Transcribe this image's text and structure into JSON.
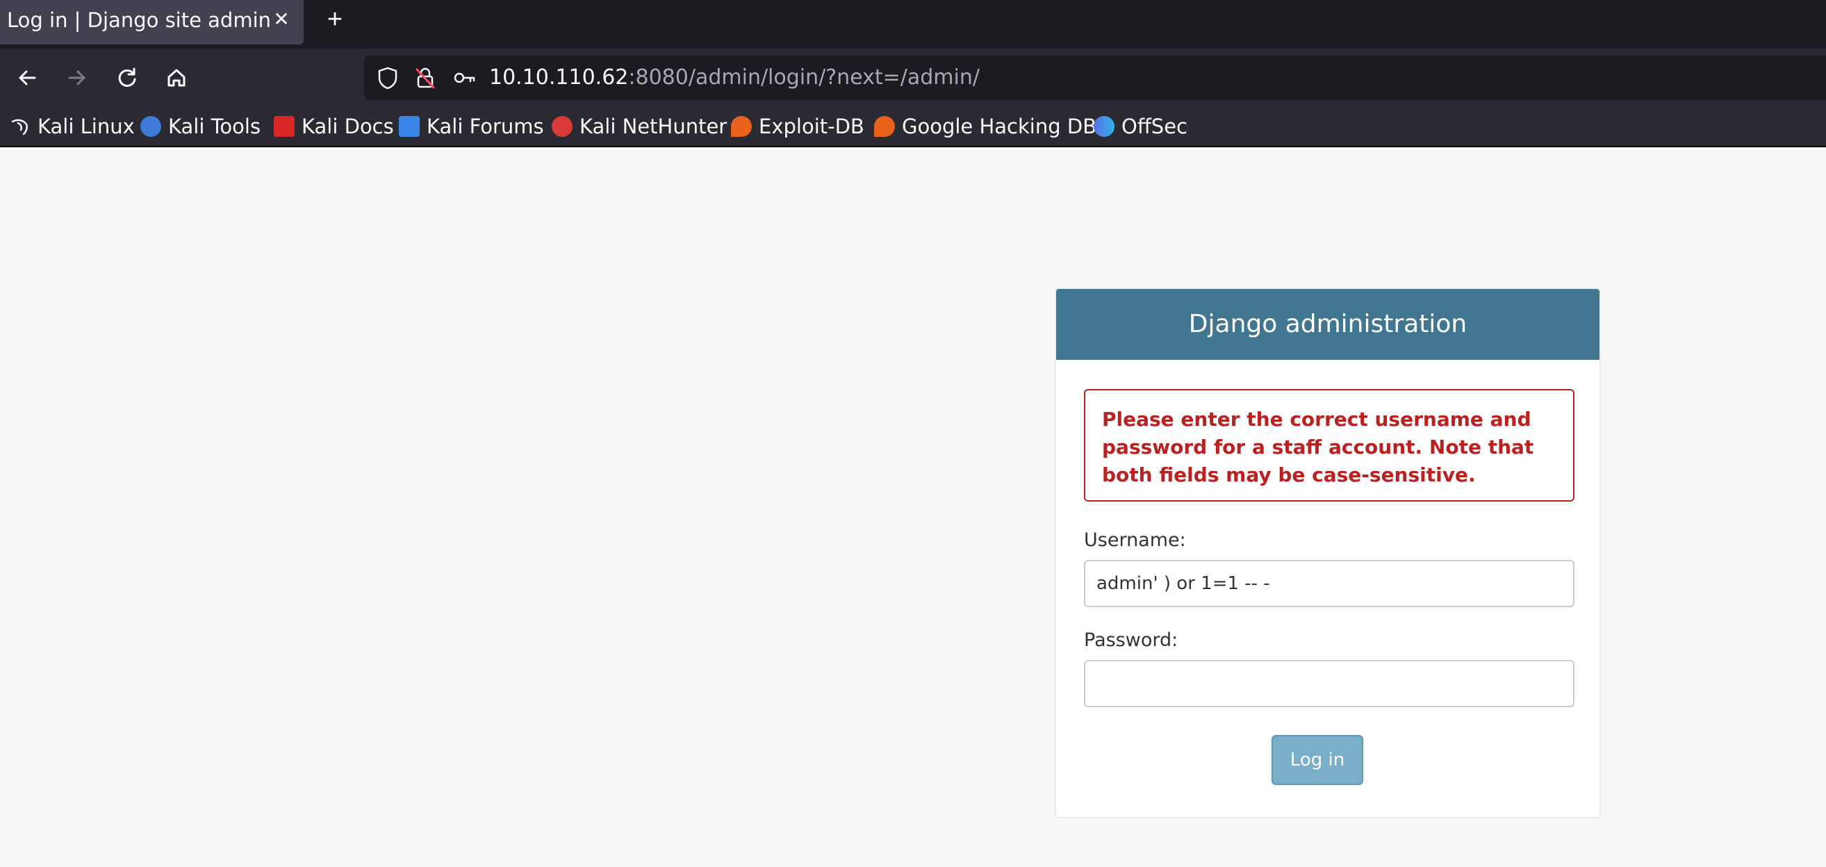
{
  "browser": {
    "tab": {
      "title": "Log in | Django site admin",
      "close_glyph": "✕"
    },
    "new_tab_glyph": "+",
    "url": {
      "host": "10.10.110.62",
      "rest": ":8080/admin/login/?next=/admin/"
    },
    "bookmarks": [
      {
        "label": "Kali Linux",
        "icon": "kali-dragon-icon",
        "color": "#1a1a1a"
      },
      {
        "label": "Kali Tools",
        "icon": "kali-tools-icon",
        "color": "#3d7bd8"
      },
      {
        "label": "Kali Docs",
        "icon": "kali-docs-icon",
        "color": "#d82727"
      },
      {
        "label": "Kali Forums",
        "icon": "kali-forums-icon",
        "color": "#3a86e8"
      },
      {
        "label": "Kali NetHunter",
        "icon": "kali-nethunter-icon",
        "color": "#d83a3a"
      },
      {
        "label": "Exploit-DB",
        "icon": "exploit-db-icon",
        "color": "#e8621c"
      },
      {
        "label": "Google Hacking DB",
        "icon": "ghdb-icon",
        "color": "#e8621c"
      },
      {
        "label": "OffSec",
        "icon": "offsec-icon",
        "color": "#5b6ee8"
      }
    ]
  },
  "login": {
    "header": "Django administration",
    "error": "Please enter the correct username and password for a staff account. Note that both fields may be case-sensitive.",
    "username_label": "Username:",
    "username_value": "admin' ) or 1=1 -- -",
    "password_label": "Password:",
    "password_value": "",
    "submit_label": "Log in"
  },
  "colors": {
    "django_header": "#417690",
    "error_red": "#ba2121",
    "button_blue": "#79aec8"
  }
}
